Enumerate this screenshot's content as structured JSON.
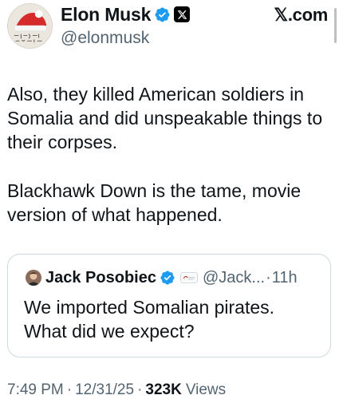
{
  "author": {
    "display_name": "Elon Musk",
    "handle": "@elonmusk",
    "verified_color": "#1d9bf0"
  },
  "header": {
    "site_label": "𝕏.com"
  },
  "tweet": {
    "paragraphs": [
      "Also, they killed American soldiers in Somalia and did unspeakable things to their corpses.",
      "Blackhawk Down is the tame, movie version of what happened."
    ]
  },
  "quote": {
    "display_name": "Jack Posobiec",
    "handle": "@Jack...",
    "separator": "·",
    "time": "11h",
    "text": "We imported Somalian pirates. What did we expect?"
  },
  "meta": {
    "time": "7:49 PM",
    "date": "12/31/25",
    "views_count": "323K",
    "views_label": "Views",
    "separator": "·"
  },
  "icons": {
    "verified": "verified-badge-icon",
    "x_logo": "x-logo-icon",
    "avatar": "santa-hat-avatar"
  }
}
